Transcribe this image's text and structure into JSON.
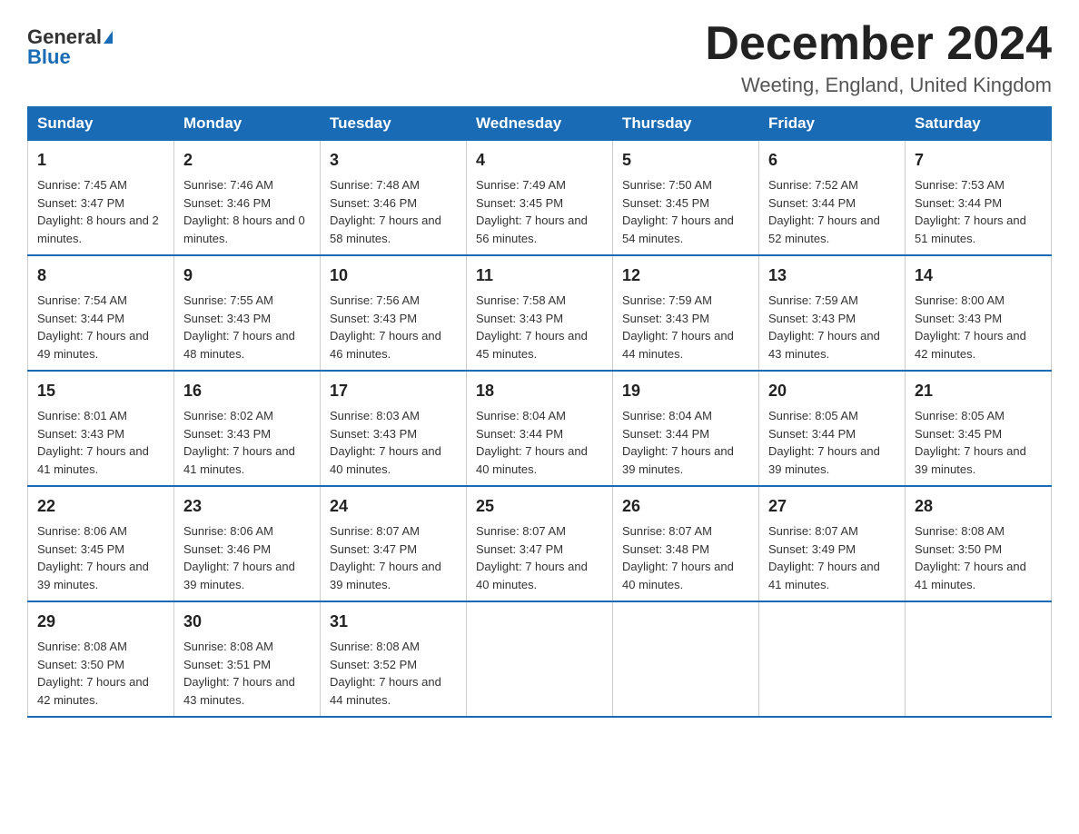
{
  "header": {
    "logo_general": "General",
    "logo_blue": "Blue",
    "month_title": "December 2024",
    "location": "Weeting, England, United Kingdom"
  },
  "days_of_week": [
    "Sunday",
    "Monday",
    "Tuesday",
    "Wednesday",
    "Thursday",
    "Friday",
    "Saturday"
  ],
  "weeks": [
    [
      {
        "day": "1",
        "sunrise": "7:45 AM",
        "sunset": "3:47 PM",
        "daylight": "8 hours and 2 minutes."
      },
      {
        "day": "2",
        "sunrise": "7:46 AM",
        "sunset": "3:46 PM",
        "daylight": "8 hours and 0 minutes."
      },
      {
        "day": "3",
        "sunrise": "7:48 AM",
        "sunset": "3:46 PM",
        "daylight": "7 hours and 58 minutes."
      },
      {
        "day": "4",
        "sunrise": "7:49 AM",
        "sunset": "3:45 PM",
        "daylight": "7 hours and 56 minutes."
      },
      {
        "day": "5",
        "sunrise": "7:50 AM",
        "sunset": "3:45 PM",
        "daylight": "7 hours and 54 minutes."
      },
      {
        "day": "6",
        "sunrise": "7:52 AM",
        "sunset": "3:44 PM",
        "daylight": "7 hours and 52 minutes."
      },
      {
        "day": "7",
        "sunrise": "7:53 AM",
        "sunset": "3:44 PM",
        "daylight": "7 hours and 51 minutes."
      }
    ],
    [
      {
        "day": "8",
        "sunrise": "7:54 AM",
        "sunset": "3:44 PM",
        "daylight": "7 hours and 49 minutes."
      },
      {
        "day": "9",
        "sunrise": "7:55 AM",
        "sunset": "3:43 PM",
        "daylight": "7 hours and 48 minutes."
      },
      {
        "day": "10",
        "sunrise": "7:56 AM",
        "sunset": "3:43 PM",
        "daylight": "7 hours and 46 minutes."
      },
      {
        "day": "11",
        "sunrise": "7:58 AM",
        "sunset": "3:43 PM",
        "daylight": "7 hours and 45 minutes."
      },
      {
        "day": "12",
        "sunrise": "7:59 AM",
        "sunset": "3:43 PM",
        "daylight": "7 hours and 44 minutes."
      },
      {
        "day": "13",
        "sunrise": "7:59 AM",
        "sunset": "3:43 PM",
        "daylight": "7 hours and 43 minutes."
      },
      {
        "day": "14",
        "sunrise": "8:00 AM",
        "sunset": "3:43 PM",
        "daylight": "7 hours and 42 minutes."
      }
    ],
    [
      {
        "day": "15",
        "sunrise": "8:01 AM",
        "sunset": "3:43 PM",
        "daylight": "7 hours and 41 minutes."
      },
      {
        "day": "16",
        "sunrise": "8:02 AM",
        "sunset": "3:43 PM",
        "daylight": "7 hours and 41 minutes."
      },
      {
        "day": "17",
        "sunrise": "8:03 AM",
        "sunset": "3:43 PM",
        "daylight": "7 hours and 40 minutes."
      },
      {
        "day": "18",
        "sunrise": "8:04 AM",
        "sunset": "3:44 PM",
        "daylight": "7 hours and 40 minutes."
      },
      {
        "day": "19",
        "sunrise": "8:04 AM",
        "sunset": "3:44 PM",
        "daylight": "7 hours and 39 minutes."
      },
      {
        "day": "20",
        "sunrise": "8:05 AM",
        "sunset": "3:44 PM",
        "daylight": "7 hours and 39 minutes."
      },
      {
        "day": "21",
        "sunrise": "8:05 AM",
        "sunset": "3:45 PM",
        "daylight": "7 hours and 39 minutes."
      }
    ],
    [
      {
        "day": "22",
        "sunrise": "8:06 AM",
        "sunset": "3:45 PM",
        "daylight": "7 hours and 39 minutes."
      },
      {
        "day": "23",
        "sunrise": "8:06 AM",
        "sunset": "3:46 PM",
        "daylight": "7 hours and 39 minutes."
      },
      {
        "day": "24",
        "sunrise": "8:07 AM",
        "sunset": "3:47 PM",
        "daylight": "7 hours and 39 minutes."
      },
      {
        "day": "25",
        "sunrise": "8:07 AM",
        "sunset": "3:47 PM",
        "daylight": "7 hours and 40 minutes."
      },
      {
        "day": "26",
        "sunrise": "8:07 AM",
        "sunset": "3:48 PM",
        "daylight": "7 hours and 40 minutes."
      },
      {
        "day": "27",
        "sunrise": "8:07 AM",
        "sunset": "3:49 PM",
        "daylight": "7 hours and 41 minutes."
      },
      {
        "day": "28",
        "sunrise": "8:08 AM",
        "sunset": "3:50 PM",
        "daylight": "7 hours and 41 minutes."
      }
    ],
    [
      {
        "day": "29",
        "sunrise": "8:08 AM",
        "sunset": "3:50 PM",
        "daylight": "7 hours and 42 minutes."
      },
      {
        "day": "30",
        "sunrise": "8:08 AM",
        "sunset": "3:51 PM",
        "daylight": "7 hours and 43 minutes."
      },
      {
        "day": "31",
        "sunrise": "8:08 AM",
        "sunset": "3:52 PM",
        "daylight": "7 hours and 44 minutes."
      },
      null,
      null,
      null,
      null
    ]
  ]
}
